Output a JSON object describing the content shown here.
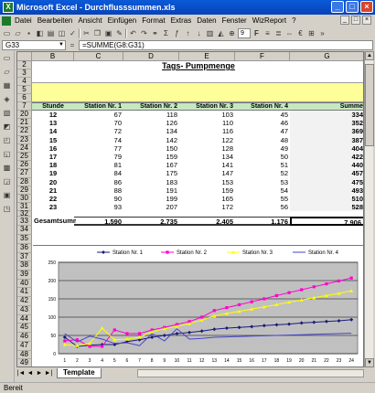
{
  "window": {
    "title": "Microsoft Excel - Durchflusssummen.xls",
    "controls": [
      "_",
      "□",
      "×"
    ]
  },
  "menu": [
    "Datei",
    "Bearbeiten",
    "Ansicht",
    "Einfügen",
    "Format",
    "Extras",
    "Daten",
    "Fenster",
    "WizReport",
    "?"
  ],
  "toolbar": {
    "font_size": "9"
  },
  "formula_bar": {
    "name_box": "G33",
    "fx": "=",
    "formula": "=SUMME(G8:G31)"
  },
  "columns": [
    "B",
    "C",
    "D",
    "E",
    "F",
    "G"
  ],
  "sheet": {
    "title": "Tags- Pumpmenge",
    "headers": [
      "Stunde",
      "Station Nr. 1",
      "Station Nr. 2",
      "Station Nr. 3",
      "Station Nr. 4",
      "Summe"
    ],
    "rows": [
      {
        "row": "20",
        "cells": [
          "12",
          "67",
          "118",
          "103",
          "45",
          "334"
        ]
      },
      {
        "row": "21",
        "cells": [
          "13",
          "70",
          "126",
          "110",
          "46",
          "352"
        ]
      },
      {
        "row": "22",
        "cells": [
          "14",
          "72",
          "134",
          "116",
          "47",
          "369"
        ]
      },
      {
        "row": "23",
        "cells": [
          "15",
          "74",
          "142",
          "122",
          "48",
          "387"
        ]
      },
      {
        "row": "24",
        "cells": [
          "16",
          "77",
          "150",
          "128",
          "49",
          "404"
        ]
      },
      {
        "row": "25",
        "cells": [
          "17",
          "79",
          "159",
          "134",
          "50",
          "422"
        ]
      },
      {
        "row": "26",
        "cells": [
          "18",
          "81",
          "167",
          "141",
          "51",
          "440"
        ]
      },
      {
        "row": "27",
        "cells": [
          "19",
          "84",
          "175",
          "147",
          "52",
          "457"
        ]
      },
      {
        "row": "28",
        "cells": [
          "20",
          "86",
          "183",
          "153",
          "53",
          "475"
        ]
      },
      {
        "row": "29",
        "cells": [
          "21",
          "88",
          "191",
          "159",
          "54",
          "493"
        ]
      },
      {
        "row": "30",
        "cells": [
          "22",
          "90",
          "199",
          "165",
          "55",
          "510"
        ]
      },
      {
        "row": "31",
        "cells": [
          "23",
          "93",
          "207",
          "172",
          "56",
          "528"
        ]
      }
    ],
    "total": {
      "row": "33",
      "label": "Gesamtsumme:",
      "cells": [
        "1.590",
        "2.735",
        "2.405",
        "1.176",
        "7.906"
      ]
    },
    "top_rows": [
      "2",
      "3",
      "4",
      "5",
      "6",
      "7"
    ],
    "chart_rows": [
      "34",
      "35",
      "36",
      "37",
      "38",
      "39",
      "40",
      "41",
      "42",
      "43",
      "44",
      "45",
      "46",
      "47",
      "48",
      "49"
    ]
  },
  "chart_data": {
    "type": "line",
    "x": [
      1,
      2,
      3,
      4,
      5,
      6,
      7,
      8,
      9,
      10,
      11,
      12,
      13,
      14,
      15,
      16,
      17,
      18,
      19,
      20,
      21,
      22,
      23,
      24
    ],
    "x_tick_labels": [
      "1",
      "2",
      "3",
      "4",
      "5",
      "6",
      "7",
      "8",
      "9",
      "10",
      "11",
      "12",
      "13",
      "14",
      "15",
      "16",
      "17",
      "18",
      "19",
      "20",
      "21",
      "22",
      "23",
      "24"
    ],
    "ylim": [
      0,
      250
    ],
    "y_ticks": [
      0,
      50,
      100,
      150,
      200,
      250
    ],
    "grid": true,
    "legend_position": "top",
    "series": [
      {
        "name": "Station Nr. 1",
        "color": "#1a1a7a",
        "marker": "diamond",
        "values": [
          45,
          20,
          23,
          25,
          25,
          33,
          38,
          45,
          50,
          55,
          58,
          62,
          67,
          70,
          72,
          74,
          77,
          79,
          81,
          84,
          86,
          88,
          90,
          93
        ]
      },
      {
        "name": "Station Nr. 2",
        "color": "#ff00cc",
        "marker": "square",
        "values": [
          35,
          38,
          20,
          20,
          65,
          55,
          55,
          65,
          72,
          80,
          88,
          100,
          118,
          126,
          134,
          142,
          150,
          159,
          167,
          175,
          183,
          191,
          199,
          207
        ]
      },
      {
        "name": "Station Nr. 3",
        "color": "#ffff00",
        "marker": "triangle",
        "values": [
          25,
          22,
          28,
          70,
          38,
          40,
          45,
          60,
          68,
          75,
          82,
          92,
          103,
          110,
          116,
          122,
          128,
          134,
          141,
          147,
          153,
          159,
          165,
          172
        ]
      },
      {
        "name": "Station Nr. 4",
        "color": "#4444cc",
        "marker": "none",
        "values": [
          55,
          32,
          48,
          40,
          28,
          30,
          22,
          55,
          35,
          68,
          40,
          42,
          45,
          46,
          47,
          48,
          49,
          50,
          51,
          52,
          53,
          54,
          55,
          56
        ]
      }
    ]
  },
  "tabs": {
    "nav": [
      "|◄",
      "◄",
      "►",
      "►|"
    ],
    "sheet_tab": "Template"
  },
  "status": "Bereit"
}
